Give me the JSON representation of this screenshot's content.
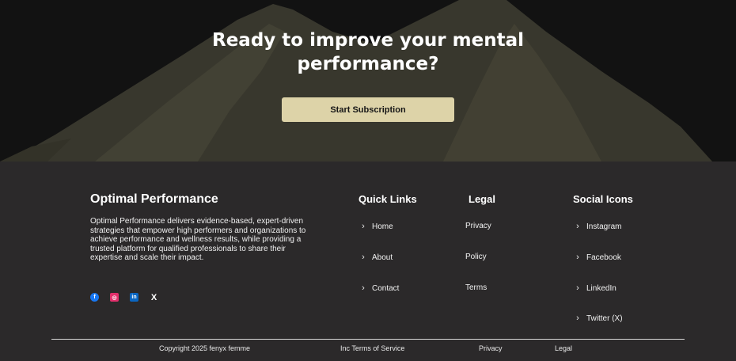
{
  "hero": {
    "title_line1": "Ready to improve your mental",
    "title_line2": "performance?",
    "cta_label": "Start Subscription"
  },
  "brand": {
    "title": "Optimal Performance",
    "description": "Optimal Performance delivers evidence-based, expert-driven strategies that empower high performers and organizations to achieve performance and wellness results, while providing a trusted platform for qualified professionals to share their expertise and scale their impact."
  },
  "social_badges": [
    {
      "icon": "facebook-icon",
      "glyph": "f"
    },
    {
      "icon": "instagram-icon",
      "glyph": "◎"
    },
    {
      "icon": "linkedin-icon",
      "glyph": "in"
    },
    {
      "icon": "x-icon",
      "glyph": "X"
    }
  ],
  "quick_links": {
    "title": "Quick Links",
    "items": [
      "Home",
      "About",
      "Contact"
    ]
  },
  "legal": {
    "title": "Legal",
    "items": [
      "Privacy",
      "Policy",
      "Terms"
    ]
  },
  "social": {
    "title": "Social Icons",
    "items": [
      "Instagram",
      "Facebook",
      "LinkedIn",
      "Twitter (X)"
    ]
  },
  "bottom_bar": {
    "copyright": "Copyright 2025 fenyx femme",
    "terms": "Inc Terms of Service",
    "privacy": "Privacy",
    "legal": "Legal"
  },
  "colors": {
    "hero_bg": "#121212",
    "mountain": "#3b3a2f",
    "cta_bg": "#ddd3a8",
    "footer_bg": "#2b292a"
  }
}
